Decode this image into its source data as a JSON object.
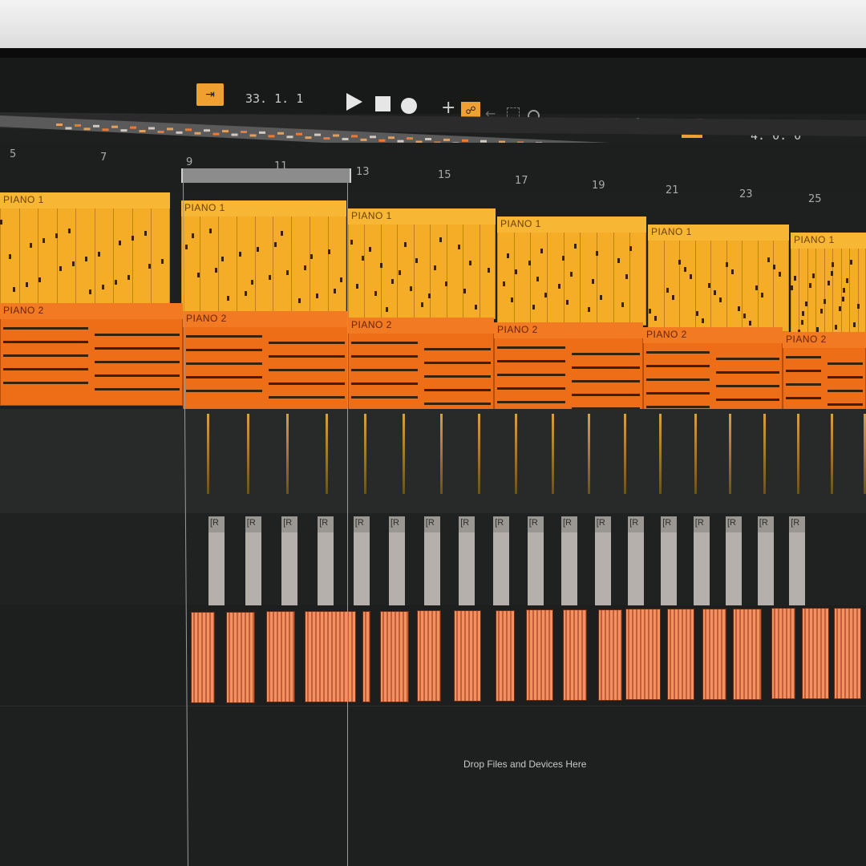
{
  "transport": {
    "follow_icon": "follow-arrow-icon",
    "song_position": "33.  1.  1",
    "loop_start": "9.  1.  1",
    "loop_length": "4.  0.  0",
    "play_icon": "play-icon",
    "stop_icon": "stop-icon",
    "record_icon": "record-icon",
    "add_icon": "plus-icon",
    "automation_arm_icon": "automation-arm-icon",
    "back_icon": "back-to-arrangement-icon",
    "capture_icon": "capture-icon",
    "loop_icon": "loop-icon",
    "punch_in_icon": "punch-in-icon",
    "punch_out_icon": "punch-out-icon",
    "accent_color": "#f0a030"
  },
  "ruler": {
    "bars": [
      "5",
      "7",
      "9",
      "11",
      "13",
      "15",
      "17",
      "19",
      "21",
      "23",
      "25"
    ]
  },
  "tracks": [
    {
      "id": "piano1",
      "clip_label": "PIANO 1",
      "color": "#f5ad28",
      "clip_count": 6
    },
    {
      "id": "piano2",
      "clip_label": "PIANO 2",
      "color": "#ee6d17",
      "clip_count": 6
    },
    {
      "id": "audio1",
      "clip_label": "",
      "color": "#3a3b3b"
    },
    {
      "id": "audio2",
      "clip_label": "[R",
      "color": "#b9b9b9"
    },
    {
      "id": "audio3",
      "clip_label": "",
      "color": "#f08a55"
    }
  ],
  "drop_zone": {
    "text": "Drop Files and Devices Here"
  }
}
